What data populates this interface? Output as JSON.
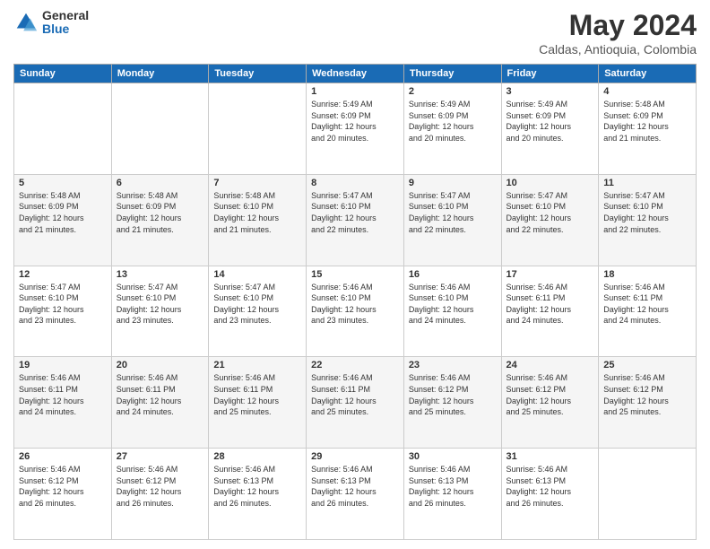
{
  "header": {
    "logo_general": "General",
    "logo_blue": "Blue",
    "month_title": "May 2024",
    "location": "Caldas, Antioquia, Colombia"
  },
  "days_of_week": [
    "Sunday",
    "Monday",
    "Tuesday",
    "Wednesday",
    "Thursday",
    "Friday",
    "Saturday"
  ],
  "weeks": [
    [
      {
        "day": "",
        "info": ""
      },
      {
        "day": "",
        "info": ""
      },
      {
        "day": "",
        "info": ""
      },
      {
        "day": "1",
        "info": "Sunrise: 5:49 AM\nSunset: 6:09 PM\nDaylight: 12 hours\nand 20 minutes."
      },
      {
        "day": "2",
        "info": "Sunrise: 5:49 AM\nSunset: 6:09 PM\nDaylight: 12 hours\nand 20 minutes."
      },
      {
        "day": "3",
        "info": "Sunrise: 5:49 AM\nSunset: 6:09 PM\nDaylight: 12 hours\nand 20 minutes."
      },
      {
        "day": "4",
        "info": "Sunrise: 5:48 AM\nSunset: 6:09 PM\nDaylight: 12 hours\nand 21 minutes."
      }
    ],
    [
      {
        "day": "5",
        "info": "Sunrise: 5:48 AM\nSunset: 6:09 PM\nDaylight: 12 hours\nand 21 minutes."
      },
      {
        "day": "6",
        "info": "Sunrise: 5:48 AM\nSunset: 6:09 PM\nDaylight: 12 hours\nand 21 minutes."
      },
      {
        "day": "7",
        "info": "Sunrise: 5:48 AM\nSunset: 6:10 PM\nDaylight: 12 hours\nand 21 minutes."
      },
      {
        "day": "8",
        "info": "Sunrise: 5:47 AM\nSunset: 6:10 PM\nDaylight: 12 hours\nand 22 minutes."
      },
      {
        "day": "9",
        "info": "Sunrise: 5:47 AM\nSunset: 6:10 PM\nDaylight: 12 hours\nand 22 minutes."
      },
      {
        "day": "10",
        "info": "Sunrise: 5:47 AM\nSunset: 6:10 PM\nDaylight: 12 hours\nand 22 minutes."
      },
      {
        "day": "11",
        "info": "Sunrise: 5:47 AM\nSunset: 6:10 PM\nDaylight: 12 hours\nand 22 minutes."
      }
    ],
    [
      {
        "day": "12",
        "info": "Sunrise: 5:47 AM\nSunset: 6:10 PM\nDaylight: 12 hours\nand 23 minutes."
      },
      {
        "day": "13",
        "info": "Sunrise: 5:47 AM\nSunset: 6:10 PM\nDaylight: 12 hours\nand 23 minutes."
      },
      {
        "day": "14",
        "info": "Sunrise: 5:47 AM\nSunset: 6:10 PM\nDaylight: 12 hours\nand 23 minutes."
      },
      {
        "day": "15",
        "info": "Sunrise: 5:46 AM\nSunset: 6:10 PM\nDaylight: 12 hours\nand 23 minutes."
      },
      {
        "day": "16",
        "info": "Sunrise: 5:46 AM\nSunset: 6:10 PM\nDaylight: 12 hours\nand 24 minutes."
      },
      {
        "day": "17",
        "info": "Sunrise: 5:46 AM\nSunset: 6:11 PM\nDaylight: 12 hours\nand 24 minutes."
      },
      {
        "day": "18",
        "info": "Sunrise: 5:46 AM\nSunset: 6:11 PM\nDaylight: 12 hours\nand 24 minutes."
      }
    ],
    [
      {
        "day": "19",
        "info": "Sunrise: 5:46 AM\nSunset: 6:11 PM\nDaylight: 12 hours\nand 24 minutes."
      },
      {
        "day": "20",
        "info": "Sunrise: 5:46 AM\nSunset: 6:11 PM\nDaylight: 12 hours\nand 24 minutes."
      },
      {
        "day": "21",
        "info": "Sunrise: 5:46 AM\nSunset: 6:11 PM\nDaylight: 12 hours\nand 25 minutes."
      },
      {
        "day": "22",
        "info": "Sunrise: 5:46 AM\nSunset: 6:11 PM\nDaylight: 12 hours\nand 25 minutes."
      },
      {
        "day": "23",
        "info": "Sunrise: 5:46 AM\nSunset: 6:12 PM\nDaylight: 12 hours\nand 25 minutes."
      },
      {
        "day": "24",
        "info": "Sunrise: 5:46 AM\nSunset: 6:12 PM\nDaylight: 12 hours\nand 25 minutes."
      },
      {
        "day": "25",
        "info": "Sunrise: 5:46 AM\nSunset: 6:12 PM\nDaylight: 12 hours\nand 25 minutes."
      }
    ],
    [
      {
        "day": "26",
        "info": "Sunrise: 5:46 AM\nSunset: 6:12 PM\nDaylight: 12 hours\nand 26 minutes."
      },
      {
        "day": "27",
        "info": "Sunrise: 5:46 AM\nSunset: 6:12 PM\nDaylight: 12 hours\nand 26 minutes."
      },
      {
        "day": "28",
        "info": "Sunrise: 5:46 AM\nSunset: 6:13 PM\nDaylight: 12 hours\nand 26 minutes."
      },
      {
        "day": "29",
        "info": "Sunrise: 5:46 AM\nSunset: 6:13 PM\nDaylight: 12 hours\nand 26 minutes."
      },
      {
        "day": "30",
        "info": "Sunrise: 5:46 AM\nSunset: 6:13 PM\nDaylight: 12 hours\nand 26 minutes."
      },
      {
        "day": "31",
        "info": "Sunrise: 5:46 AM\nSunset: 6:13 PM\nDaylight: 12 hours\nand 26 minutes."
      },
      {
        "day": "",
        "info": ""
      }
    ]
  ]
}
